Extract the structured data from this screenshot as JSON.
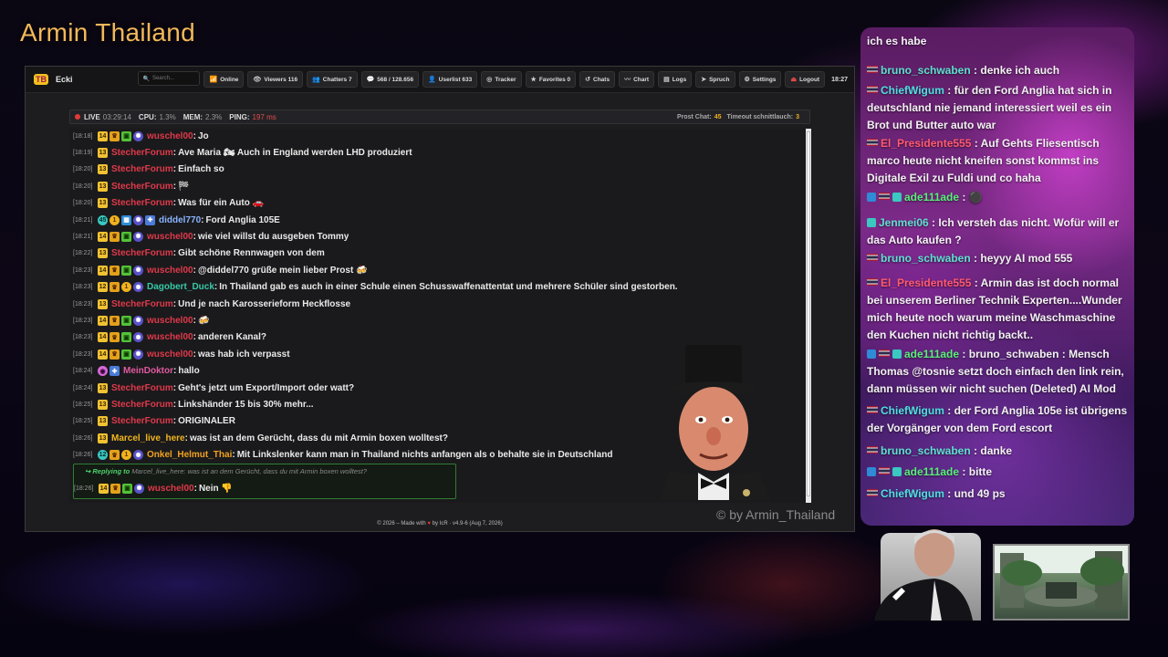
{
  "stream": {
    "title": "Armin Thailand",
    "watermark": "© by Armin_Thailand"
  },
  "app": {
    "logo_text": "TB",
    "name": "Ecki",
    "search_placeholder": "Search...",
    "toolbar": [
      {
        "label": "Online",
        "icon": "wifi-icon",
        "glyph": "📶"
      },
      {
        "label": "Viewers 116",
        "icon": "eye-icon",
        "glyph": "👁"
      },
      {
        "label": "Chatters 7",
        "icon": "users-icon",
        "glyph": "👥"
      },
      {
        "label": "568 / 128.656",
        "icon": "chat-icon",
        "glyph": "💬"
      },
      {
        "label": "Userlist 633",
        "icon": "user-icon",
        "glyph": "👤"
      },
      {
        "label": "Tracker",
        "icon": "tracker-icon",
        "glyph": "◎"
      },
      {
        "label": "Favorites 0",
        "icon": "star-icon",
        "glyph": "★"
      },
      {
        "label": "Chats",
        "icon": "history-icon",
        "glyph": "↺"
      },
      {
        "label": "Chart",
        "icon": "chart-icon",
        "glyph": "〰"
      },
      {
        "label": "Logs",
        "icon": "log-icon",
        "glyph": "▤"
      },
      {
        "label": "Spruch",
        "icon": "speech-icon",
        "glyph": "➤"
      },
      {
        "label": "Settings",
        "icon": "gear-icon",
        "glyph": "⚙"
      },
      {
        "label": "Logout",
        "icon": "logout-icon",
        "glyph": "⏏"
      }
    ],
    "clock": "18:27",
    "status": {
      "live_label": "LIVE",
      "live_time": "03:29:14",
      "cpu_label": "CPU:",
      "cpu_value": "1.3%",
      "mem_label": "MEM:",
      "mem_value": "2.3%",
      "ping_label": "PING:",
      "ping_value": "197 ms",
      "prost_label": "Prost Chat:",
      "prost_value": "45",
      "timeout_label": "Timeout schnittlauch:",
      "timeout_value": "3"
    },
    "messages": [
      {
        "ts": "[18:18]",
        "badges": [
          "sub:14",
          "crown",
          "gift",
          "globe"
        ],
        "user": "wuschel00",
        "ucls": "u-red",
        "text": "Jo"
      },
      {
        "ts": "[18:19]",
        "badges": [
          "sub:13"
        ],
        "user": "StecherForum",
        "ucls": "u-red",
        "text": "Ave Maria 🏍 Auch in England werden LHD produziert"
      },
      {
        "ts": "[18:20]",
        "badges": [
          "sub:13"
        ],
        "user": "StecherForum",
        "ucls": "u-red",
        "text": "Einfach so"
      },
      {
        "ts": "[18:20]",
        "badges": [
          "sub:13"
        ],
        "user": "StecherForum",
        "ucls": "u-red",
        "text": "🏁"
      },
      {
        "ts": "[18:20]",
        "badges": [
          "sub:13"
        ],
        "user": "StecherForum",
        "ucls": "u-red",
        "text": "Was für ein Auto 🚗"
      },
      {
        "ts": "[18:21]",
        "badges": [
          "bits:45",
          "coin",
          "tv",
          "globe",
          "cross"
        ],
        "user": "diddel770",
        "ucls": "u-blue",
        "text": "Ford Anglia 105E"
      },
      {
        "ts": "[18:21]",
        "badges": [
          "sub:14",
          "crown",
          "gift",
          "globe"
        ],
        "user": "wuschel00",
        "ucls": "u-red",
        "text": "wie viel willst du ausgeben Tommy"
      },
      {
        "ts": "[18:22]",
        "badges": [
          "sub:13"
        ],
        "user": "StecherForum",
        "ucls": "u-red",
        "text": "Gibt schöne Rennwagen von dem"
      },
      {
        "ts": "[18:23]",
        "badges": [
          "sub:14",
          "crown",
          "gift",
          "globe"
        ],
        "user": "wuschel00",
        "ucls": "u-red",
        "text": "@diddel770 grüße mein lieber Prost 🍻"
      },
      {
        "ts": "[18:23]",
        "badges": [
          "sub:12",
          "crown",
          "coin",
          "globe"
        ],
        "user": "Dagobert_Duck",
        "ucls": "u-teal",
        "text": "In Thailand gab es auch in einer Schule einen Schusswaffenattentat und mehrere Schüler sind gestorben."
      },
      {
        "ts": "[18:23]",
        "badges": [
          "sub:13"
        ],
        "user": "StecherForum",
        "ucls": "u-red",
        "text": "Und je nach Karosserieform Heckflosse"
      },
      {
        "ts": "[18:23]",
        "badges": [
          "sub:14",
          "crown",
          "gift",
          "globe"
        ],
        "user": "wuschel00",
        "ucls": "u-red",
        "text": "🍻"
      },
      {
        "ts": "[18:23]",
        "badges": [
          "sub:14",
          "crown",
          "gift",
          "globe"
        ],
        "user": "wuschel00",
        "ucls": "u-red",
        "text": "anderen Kanal?"
      },
      {
        "ts": "[18:23]",
        "badges": [
          "sub:14",
          "crown",
          "gift",
          "globe"
        ],
        "user": "wuschel00",
        "ucls": "u-red",
        "text": "was hab ich verpasst"
      },
      {
        "ts": "[18:24]",
        "badges": [
          "drop",
          "cross"
        ],
        "user": "MeinDoktor",
        "ucls": "u-pink",
        "text": "hallo"
      },
      {
        "ts": "[18:24]",
        "badges": [
          "sub:13"
        ],
        "user": "StecherForum",
        "ucls": "u-red",
        "text": "Geht's jetzt um Export/Import oder watt?"
      },
      {
        "ts": "[18:25]",
        "badges": [
          "sub:13"
        ],
        "user": "StecherForum",
        "ucls": "u-red",
        "text": "Linkshänder 15 bis 30% mehr..."
      },
      {
        "ts": "[18:25]",
        "badges": [
          "sub:13"
        ],
        "user": "StecherForum",
        "ucls": "u-red",
        "text": "ORIGINALER"
      },
      {
        "ts": "[18:26]",
        "badges": [
          "sub:13"
        ],
        "user": "Marcel_live_here",
        "ucls": "u-yellow",
        "text": "was ist an dem Gerücht, dass du mit Armin boxen wolltest?"
      },
      {
        "ts": "[18:26]",
        "badges": [
          "bits:12",
          "crown",
          "coin",
          "globe"
        ],
        "user": "Onkel_Helmut_Thai",
        "ucls": "u-orange",
        "text": "Mit Linkslenker kann man in Thailand nichts anfangen als o behalte sie in Deutschland"
      }
    ],
    "reply": {
      "label": "Replying to",
      "quote": "Marcel_live_here: was ist an dem Gerücht, dass du mit Armin boxen wolltest?",
      "ts": "[18:26]",
      "badges": [
        "sub:14",
        "crown",
        "gift",
        "globe"
      ],
      "user": "wuschel00",
      "ucls": "u-red",
      "text": "Nein 👎"
    },
    "footer": {
      "pre": "© 2026 – Made with",
      "heart": "♥",
      "post": "by IcR · v4.9-6 (Aug 7, 2026)"
    }
  },
  "side_chat": [
    {
      "prefix": "",
      "user": "",
      "ucls": "",
      "text": "ich es habe"
    },
    {
      "prefix": "flag",
      "user": "bruno_schwaben",
      "ucls": "rc-u-teal",
      "text": "denke ich auch"
    },
    {
      "prefix": "flag",
      "user": "ChiefWigum",
      "ucls": "rc-u-cyan",
      "text": "für den Ford Anglia hat sich in deutschland nie jemand interessiert weil es ein Brot und Butter auto war"
    },
    {
      "prefix": "flag",
      "user": "El_Presidente555",
      "ucls": "rc-u-red",
      "text": "Auf Gehts Fliesentisch marco heute nicht kneifen sonst kommst ins Digitale Exil zu Fuldi und co haha"
    },
    {
      "prefix": "multi",
      "user": "ade111ade",
      "ucls": "rc-u-green",
      "text": "⚫"
    },
    {
      "prefix": "mini",
      "user": "Jenmei06",
      "ucls": "rc-u-teal",
      "text": "Ich versteh das nicht. Wofür will er das Auto kaufen ?"
    },
    {
      "prefix": "flag",
      "user": "bruno_schwaben",
      "ucls": "rc-u-teal",
      "text": "heyyy AI mod 555"
    },
    {
      "prefix": "flag",
      "user": "El_Presidente555",
      "ucls": "rc-u-red",
      "text": "Armin das ist doch normal bei unserem Berliner Technik Experten....Wunder mich heute noch warum meine Waschmaschine den Kuchen nicht richtig backt.."
    },
    {
      "prefix": "multi",
      "user": "ade111ade",
      "ucls": "rc-u-green",
      "text": "bruno_schwaben : Mensch Thomas @tosnie setzt doch einfach den link rein, dann müssen wir nicht suchen (Deleted) AI Mod"
    },
    {
      "prefix": "flag",
      "user": "ChiefWigum",
      "ucls": "rc-u-cyan",
      "text": "der Ford Anglia 105e ist übrigens der Vorgänger von dem Ford escort"
    },
    {
      "prefix": "flag",
      "user": "bruno_schwaben",
      "ucls": "rc-u-teal",
      "text": "danke"
    },
    {
      "prefix": "multi",
      "user": "ade111ade",
      "ucls": "rc-u-green",
      "text": "bitte"
    },
    {
      "prefix": "flag",
      "user": "ChiefWigum",
      "ucls": "rc-u-cyan",
      "text": "und 49 ps"
    }
  ]
}
